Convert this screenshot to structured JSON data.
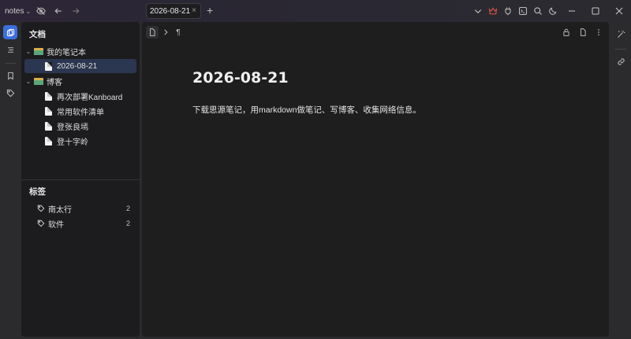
{
  "titlebar": {
    "workspace_name": "notes",
    "tab_label": "2026-08-21",
    "icons": [
      "eye-off-icon",
      "back-icon",
      "forward-icon",
      "chevron-down-icon",
      "crown-icon",
      "plugin-icon",
      "terminal-icon",
      "search-icon",
      "moon-icon"
    ],
    "accent_color": "#3b6fe0"
  },
  "ribbon": {
    "items": [
      "docs-icon",
      "outline-icon",
      "bookmark-icon",
      "tag-icon"
    ]
  },
  "sidebar": {
    "docs_title": "文档",
    "notebooks": [
      {
        "label": "我的笔记本",
        "docs": [
          "2026-08-21"
        ]
      },
      {
        "label": "博客",
        "docs": [
          "再次部署Kanboard",
          "常用软件清单",
          "登张良墕",
          "登十字岭"
        ]
      }
    ],
    "tags_title": "标签",
    "tags": [
      {
        "label": "南太行",
        "count": "2"
      },
      {
        "label": "软件",
        "count": "2"
      }
    ]
  },
  "editor": {
    "title": "2026-08-21",
    "body": "下载思源笔记，用markdown做笔记、写博客、收集网络信息。",
    "breadcrumb_symbol": "¶"
  }
}
